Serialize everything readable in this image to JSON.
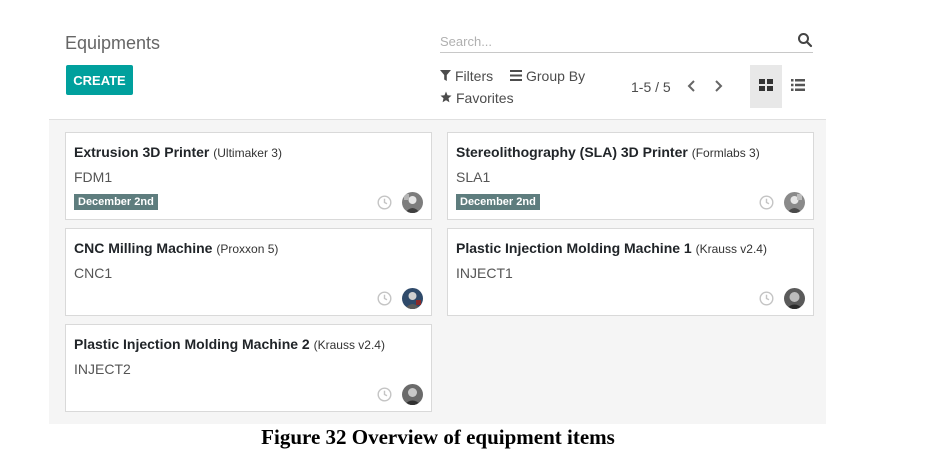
{
  "page": {
    "title": "Equipments",
    "create_label": "CREATE"
  },
  "search": {
    "placeholder": "Search...",
    "icon": "search-icon"
  },
  "filters": {
    "filters_label": "Filters",
    "groupby_label": "Group By",
    "favorites_label": "Favorites"
  },
  "pager": {
    "value": "1-5 / 5"
  },
  "views": {
    "active": "kanban",
    "options": [
      "kanban",
      "list"
    ]
  },
  "cards": [
    {
      "name": "Extrusion 3D Printer",
      "model": "(Ultimaker 3)",
      "code": "FDM1",
      "badge": "December 2nd"
    },
    {
      "name": "Stereolithography (SLA) 3D Printer",
      "model": "(Formlabs 3)",
      "code": "SLA1",
      "badge": "December 2nd"
    },
    {
      "name": "CNC Milling Machine",
      "model": "(Proxxon 5)",
      "code": "CNC1",
      "badge": ""
    },
    {
      "name": "Plastic Injection Molding Machine 1",
      "model": "(Krauss v2.4)",
      "code": "INJECT1",
      "badge": ""
    },
    {
      "name": "Plastic Injection Molding Machine 2",
      "model": "(Krauss v2.4)",
      "code": "INJECT2",
      "badge": ""
    }
  ],
  "caption": "Figure 32 Overview of equipment items",
  "colors": {
    "accent": "#00a09d",
    "badge": "#5e7d7e",
    "background": "#f5f5f5"
  }
}
